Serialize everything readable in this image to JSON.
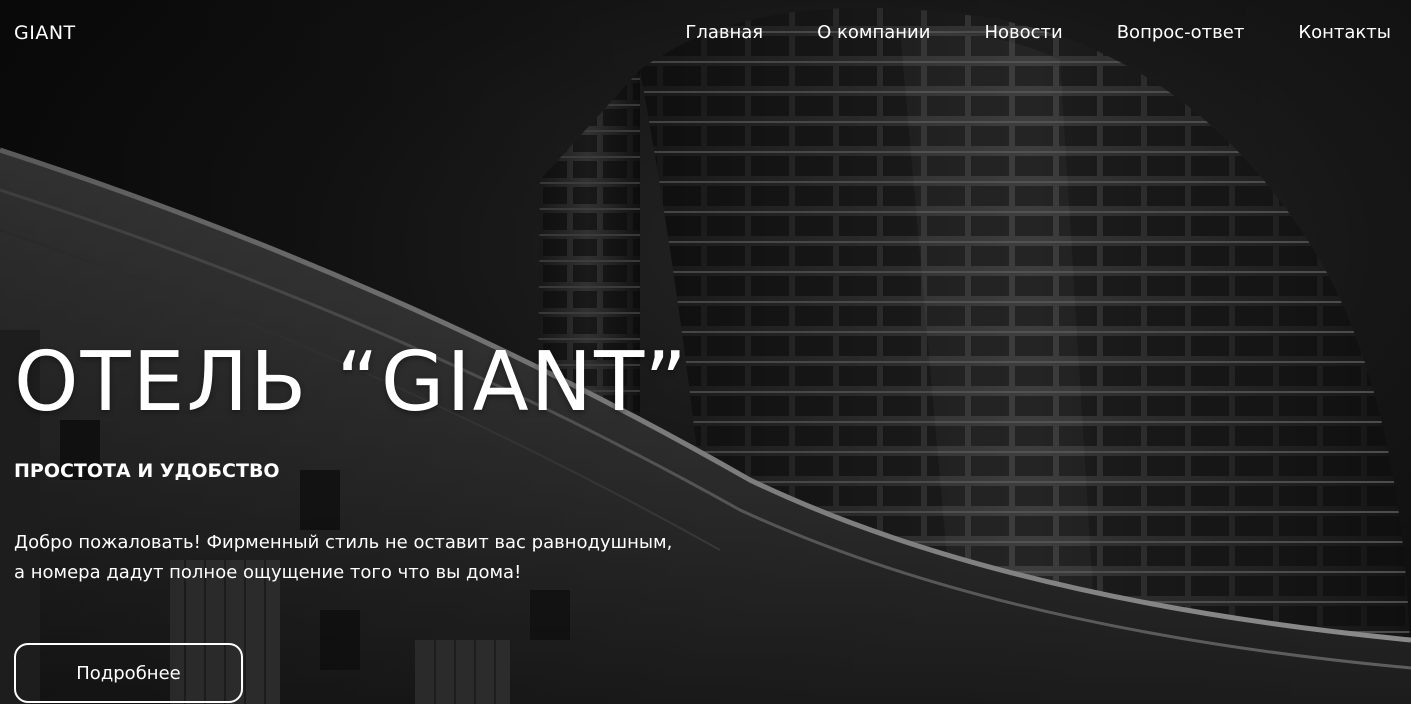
{
  "header": {
    "logo": "GIANT",
    "nav": [
      {
        "label": "Главная"
      },
      {
        "label": "О компании"
      },
      {
        "label": "Новости"
      },
      {
        "label": "Вопрос-ответ"
      },
      {
        "label": "Контакты"
      }
    ]
  },
  "hero": {
    "title": "ОТЕЛЬ “GIANT”",
    "subtitle": "ПРОСТОТА И УДОБСТВО",
    "description_line1": "Добро пожаловать! Фирменный стиль не оставит вас равнодушным,",
    "description_line2": "а номера дадут полное ощущение того что вы дома!",
    "cta_label": "Подробнее",
    "background_image": "black-and-white-skyscraper-photo"
  },
  "colors": {
    "text": "#ffffff",
    "background": "#0e0e0e"
  }
}
